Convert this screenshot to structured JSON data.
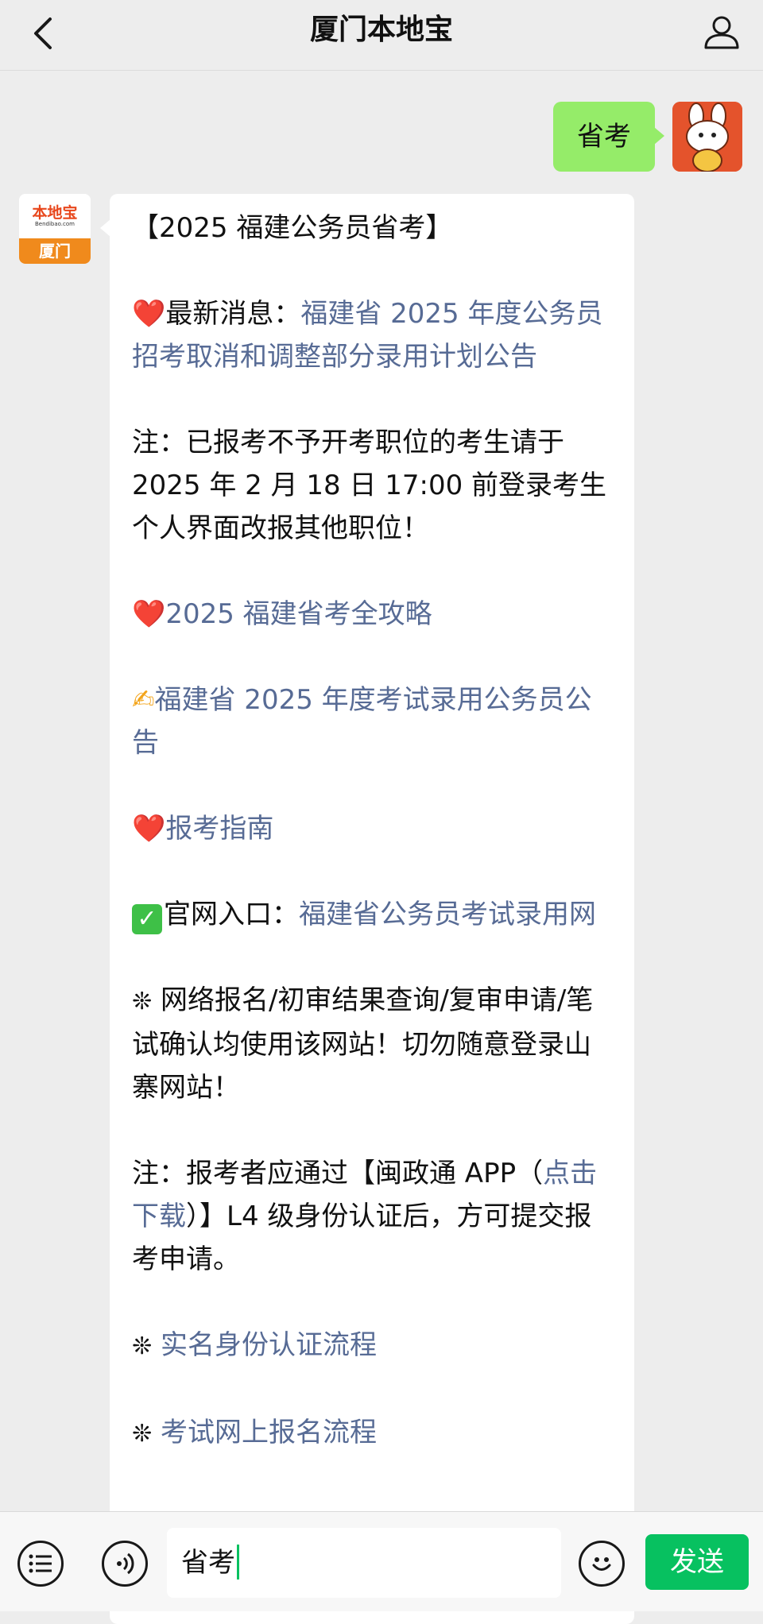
{
  "header": {
    "title": "厦门本地宝",
    "back_icon": "chevron-left-icon",
    "user_icon": "user-icon"
  },
  "sent_message": {
    "text": "省考"
  },
  "bot": {
    "avatar_brand": "本地宝",
    "avatar_domain": "Bendibao.com",
    "avatar_city": "厦门"
  },
  "reply": {
    "heading": "【2025 福建公务员省考】",
    "news_label": "最新消息：",
    "news_link": "福建省 2025 年度公务员招考取消和调整部分录用计划公告",
    "note1": "注：已报考不予开考职位的考生请于 2025 年 2 月 18 日 17:00 前登录考生个人界面改报其他职位！",
    "strategy_link": "2025 福建省考全攻略",
    "announcement_link": "福建省 2025 年度考试录用公务员公告",
    "guide_link": "报考指南",
    "official_label": "官网入口：",
    "official_link": "福建省公务员考试录用网",
    "tip": "网络报名/初审结果查询/复审申请/笔试确认均使用该网站！切勿随意登录山寨网站！",
    "note2_prefix": "注：报考者应通过【闽政通 APP（",
    "note2_link": "点击下载",
    "note2_suffix": "）】L4 级身份认证后，方可提交报考申请。",
    "auth_link": "实名身份认证流程",
    "signup_link": "考试网上报名流程",
    "heart": "❤️",
    "pen": "✍",
    "check": "✓",
    "asterisk": "❊"
  },
  "input": {
    "value": "省考",
    "send_label": "发送"
  },
  "colors": {
    "link": "#576b95",
    "sent_bubble": "#95ec69",
    "send_button": "#07c160"
  }
}
